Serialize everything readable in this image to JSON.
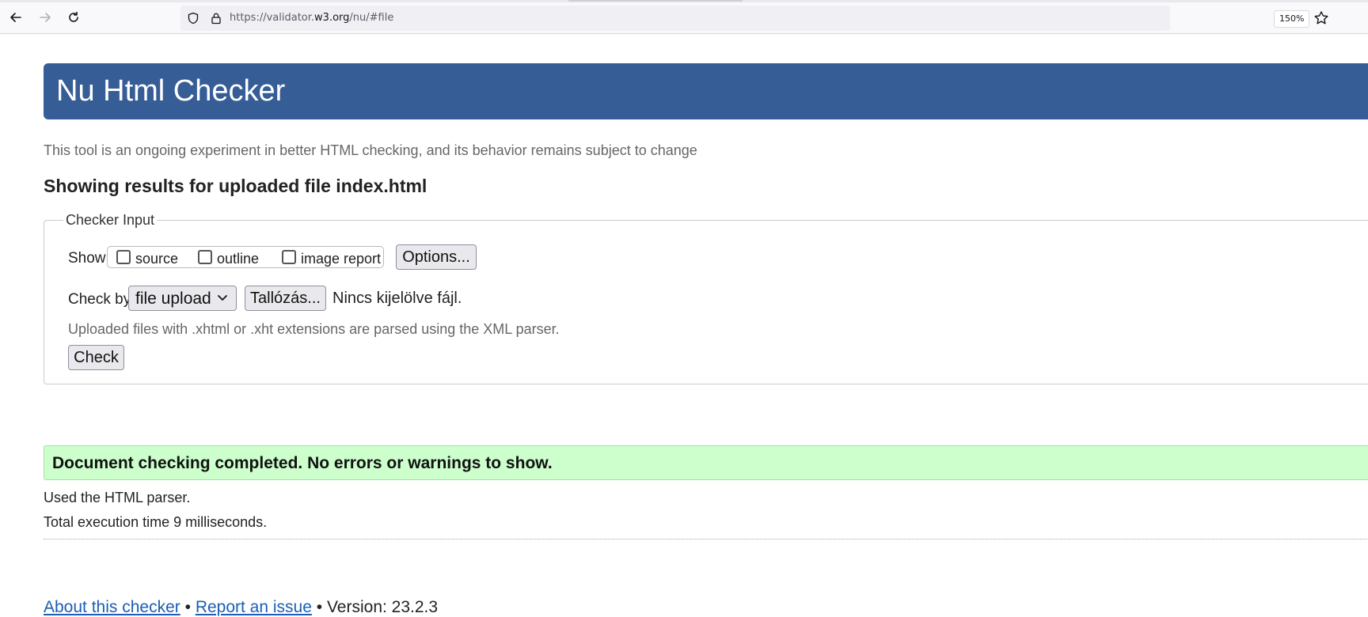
{
  "browser": {
    "url_prefix": "https://validator.",
    "url_domain": "w3.org",
    "url_suffix": "/nu/#file",
    "zoom": "150%"
  },
  "page": {
    "title": "Nu Html Checker",
    "tagline": "This tool is an ongoing experiment in better HTML checking, and its behavior remains subject to change",
    "results_heading": "Showing results for uploaded file index.html"
  },
  "form": {
    "legend": "Checker Input",
    "show_label": "Show",
    "show_options": [
      {
        "label": "source",
        "checked": false
      },
      {
        "label": "outline",
        "checked": false
      },
      {
        "label": "image report",
        "checked": false
      }
    ],
    "options_button": "Options...",
    "check_by_label": "Check by",
    "check_by_value": "file upload",
    "browse_button": "Tallózás...",
    "no_file_text": "Nincs kijelölve fájl.",
    "xml_note": "Uploaded files with .xhtml or .xht extensions are parsed using the XML parser.",
    "check_button": "Check"
  },
  "results": {
    "success_message": "Document checking completed. No errors or warnings to show.",
    "parser_info": "Used the HTML parser.",
    "execution_time": "Total execution time 9 milliseconds."
  },
  "footer": {
    "about_link": "About this checker",
    "separator": "•",
    "report_link": "Report an issue",
    "version": "Version: 23.2.3"
  },
  "colors": {
    "banner": "#365d95",
    "success": "#ccffcc",
    "link": "#1a5fb4"
  }
}
